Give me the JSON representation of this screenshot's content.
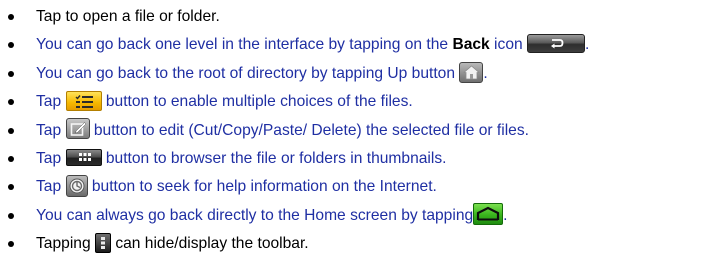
{
  "items": [
    {
      "text": "Tap to open a file or folder."
    },
    {
      "before": "You can go back one level in the interface by tapping on the ",
      "bold": "Back",
      "after": " icon",
      "trail": "."
    },
    {
      "before": "You can go back to the root of directory by tapping Up button",
      "trail": "."
    },
    {
      "before": "Tap",
      "after": "button to enable multiple choices of the files."
    },
    {
      "before": "Tap",
      "after": "button to edit (Cut/Copy/Paste/ Delete) the selected file or files."
    },
    {
      "before": "Tap",
      "after": "button to browser the file or folders in thumbnails."
    },
    {
      "before": "Tap",
      "after": "button to seek for help information on the Internet."
    },
    {
      "before": "You can always go back directly to the Home screen by tapping",
      "trail": "."
    },
    {
      "before": "Tapping",
      "after": "can hide/display the toolbar."
    }
  ],
  "icons": {
    "back": "back-arrow-icon",
    "up": "home-folder-icon",
    "multi": "multi-select-icon",
    "edit": "edit-icon",
    "thumbs": "thumbnail-grid-icon",
    "help": "help-icon",
    "home": "home-screen-icon",
    "toolbar": "toolbar-toggle-icon"
  },
  "colors": {
    "primary_text": "#000000",
    "blue_text": "#1f2fa3"
  }
}
